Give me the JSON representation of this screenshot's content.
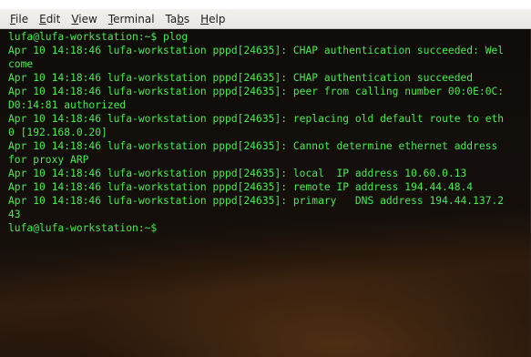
{
  "menu": [
    {
      "pre": "",
      "mn": "F",
      "post": "ile"
    },
    {
      "pre": "",
      "mn": "E",
      "post": "dit"
    },
    {
      "pre": "",
      "mn": "V",
      "post": "iew"
    },
    {
      "pre": "",
      "mn": "T",
      "post": "erminal"
    },
    {
      "pre": "Ta",
      "mn": "b",
      "post": "s"
    },
    {
      "pre": "",
      "mn": "H",
      "post": "elp"
    }
  ],
  "terminal": {
    "lines": [
      "lufa@lufa-workstation:~$ plog",
      "Apr 10 14:18:46 lufa-workstation pppd[24635]: CHAP authentication succeeded: Wel",
      "come",
      "Apr 10 14:18:46 lufa-workstation pppd[24635]: CHAP authentication succeeded",
      "Apr 10 14:18:46 lufa-workstation pppd[24635]: peer from calling number 00:0E:0C:",
      "D0:14:81 authorized",
      "Apr 10 14:18:46 lufa-workstation pppd[24635]: replacing old default route to eth",
      "0 [192.168.0.20]",
      "Apr 10 14:18:46 lufa-workstation pppd[24635]: Cannot determine ethernet address",
      "for proxy ARP",
      "Apr 10 14:18:46 lufa-workstation pppd[24635]: local  IP address 10.60.0.13",
      "Apr 10 14:18:46 lufa-workstation pppd[24635]: remote IP address 194.44.48.4",
      "Apr 10 14:18:46 lufa-workstation pppd[24635]: primary   DNS address 194.44.137.2",
      "43",
      "lufa@lufa-workstation:~$ "
    ],
    "text_color": "#49ec4d"
  }
}
